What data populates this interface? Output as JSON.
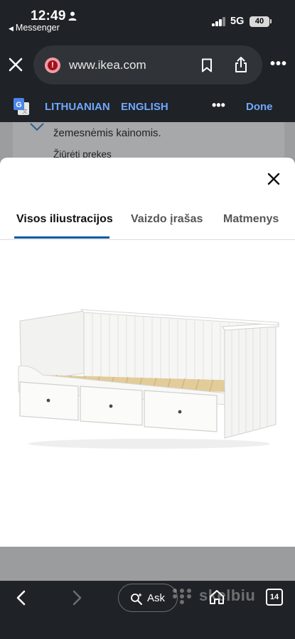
{
  "status_bar": {
    "time": "12:49",
    "back_app": "Messenger",
    "network": "5G",
    "battery": "40"
  },
  "browser": {
    "url": "www.ikea.com",
    "icons": [
      "close-icon",
      "site-alert-icon",
      "bookmark-icon",
      "share-icon",
      "more-icon"
    ]
  },
  "translate_bar": {
    "source_language": "LITHUANIAN",
    "target_language": "ENGLISH",
    "done_label": "Done"
  },
  "background_page": {
    "text_line": "žemesnėmis kainomis.",
    "link": "Žiūrėti prekes"
  },
  "gallery_modal": {
    "tabs": [
      {
        "label": "Visos iliustracijos",
        "active": true
      },
      {
        "label": "Vaizdo įrašas",
        "active": false
      },
      {
        "label": "Matmenys",
        "active": false
      }
    ],
    "image": "white daybed with three drawers"
  },
  "bottom_toolbar": {
    "ask_label": "Ask",
    "watermark": "skelbiu",
    "tab_count": "14",
    "icons": [
      "back-icon",
      "forward-icon",
      "sparkle-search-icon",
      "home-icon",
      "tabs-icon"
    ]
  },
  "colors": {
    "accent_blue": "#0058a3",
    "link_blue": "#6fa8ff",
    "chrome_dark": "#1f2226"
  }
}
